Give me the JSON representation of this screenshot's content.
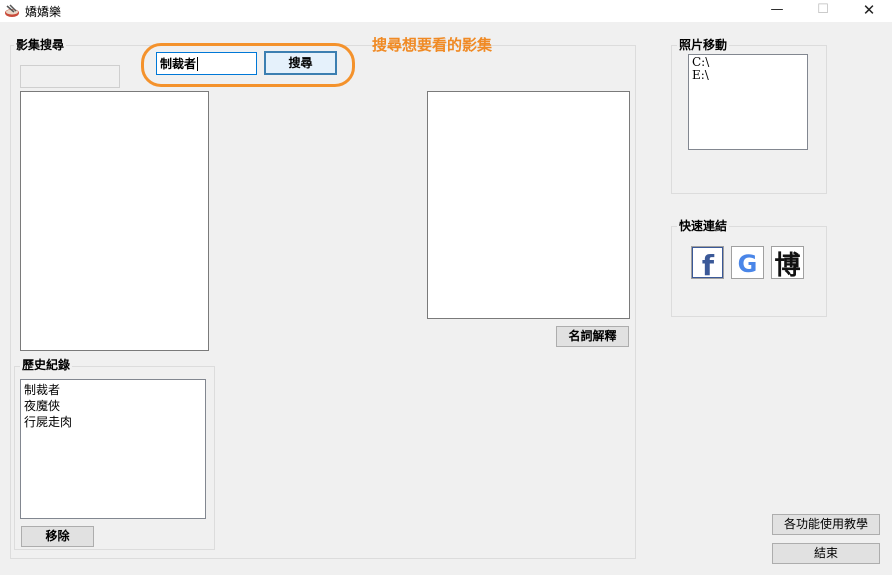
{
  "window": {
    "title": "嬌嬌樂"
  },
  "annotation": {
    "text": "搜尋想要看的影集"
  },
  "search_panel": {
    "legend": "影集搜尋",
    "input_value": "制裁者",
    "search_button": "搜尋",
    "glossary_button": "名詞解釋"
  },
  "history": {
    "legend": "歷史紀錄",
    "items": [
      "制裁者",
      "夜魔俠",
      "行屍走肉"
    ],
    "remove_button": "移除"
  },
  "photo_move": {
    "legend": "照片移動",
    "drives": [
      "C:\\",
      "E:\\"
    ]
  },
  "quick_links": {
    "legend": "快速連結",
    "facebook_glyph": "f",
    "google_glyph": "G",
    "blog_glyph": "博",
    "icons": [
      "facebook-icon",
      "google-icon",
      "blog-icon"
    ]
  },
  "footer": {
    "tutorial_button": "各功能使用教學",
    "exit_button": "結束"
  },
  "colors": {
    "annotation": "#f08a24",
    "facebook": "#3b5998"
  }
}
